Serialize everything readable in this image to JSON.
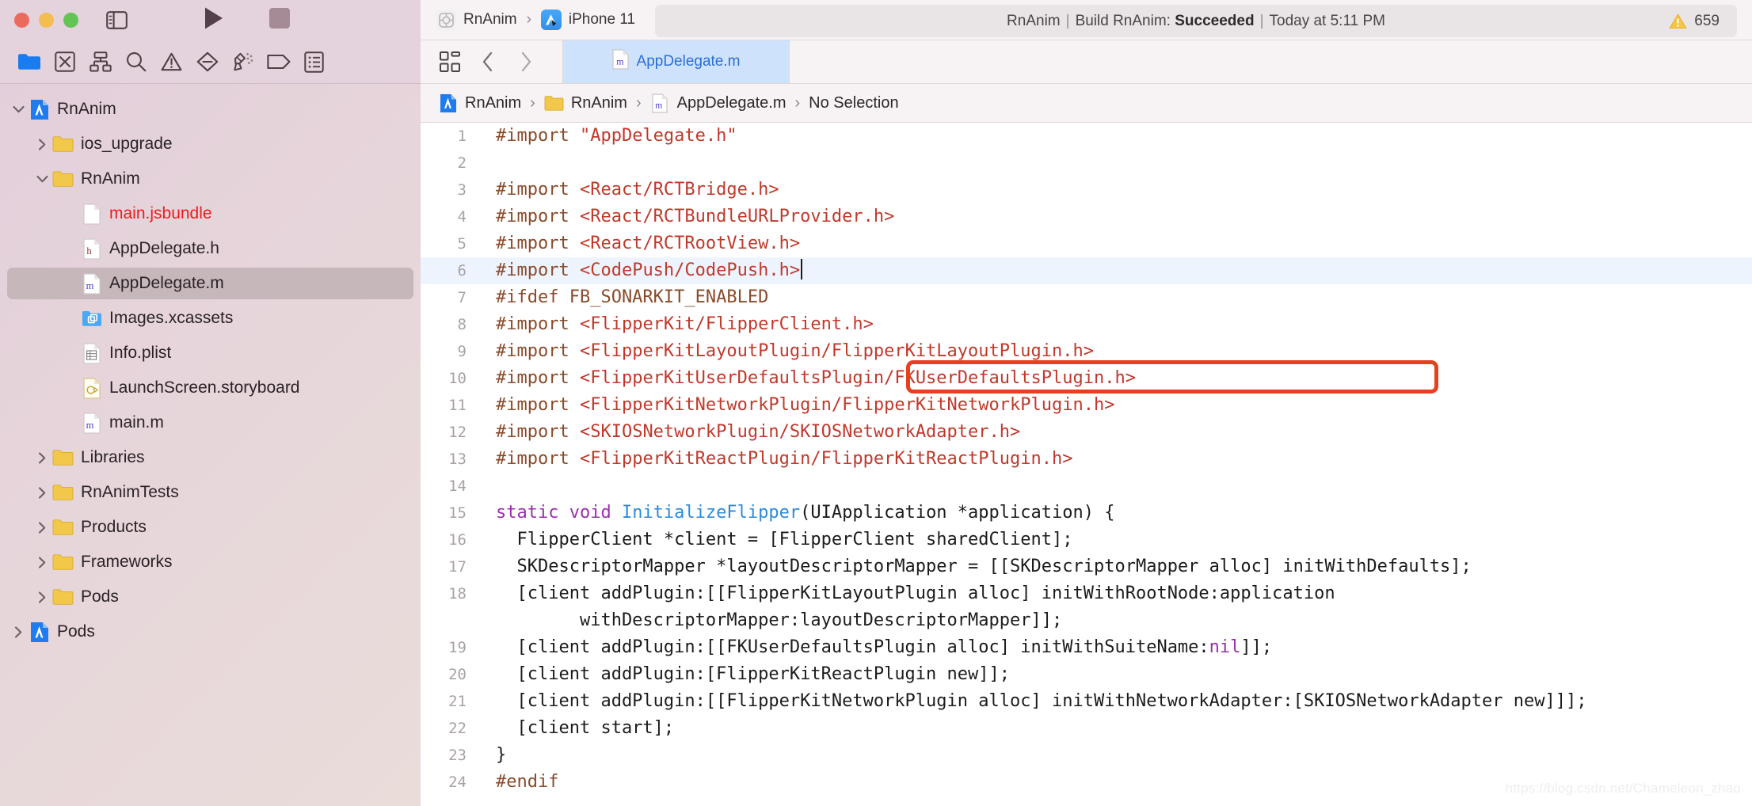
{
  "window": {
    "traffic_lights": [
      "close",
      "minimize",
      "zoom"
    ],
    "colors": {
      "titlebar_bg": "#e4d2dc",
      "toolbar_bg": "#f7f3f4",
      "sidebar_selection": "#c6b7bb",
      "tab_active_bg": "#cfe2fb",
      "tab_active_text": "#2b6fd4",
      "highlight_line_bg": "#eef4fd",
      "annotation_box": "#e8401f",
      "string_red": "#c0392b",
      "keyword_purple": "#9b2fae",
      "function_blue": "#2e8bd8",
      "preproc_brown": "#8a4b2a",
      "error_red": "#ee1c1c",
      "warning_yellow": "#f4bd4f"
    }
  },
  "toolbar": {
    "run_label": "Run",
    "stop_label": "Stop",
    "sidebar_toggle_label": "Toggle Navigator",
    "scheme": {
      "project_name": "RnAnim",
      "separator": "›",
      "destination": "iPhone 11"
    },
    "status": {
      "scheme": "RnAnim",
      "separator": "|",
      "action": "Build RnAnim:",
      "result": "Succeeded",
      "time": "Today at 5:11 PM"
    },
    "warnings": {
      "icon": "warning-triangle-icon",
      "count": "659"
    }
  },
  "navigator_toolbar": {
    "items": [
      {
        "name": "project-navigator",
        "icon": "folder-icon",
        "active": true
      },
      {
        "name": "source-control-navigator",
        "icon": "source-control-icon",
        "active": false
      },
      {
        "name": "symbol-navigator",
        "icon": "hierarchy-icon",
        "active": false
      },
      {
        "name": "find-navigator",
        "icon": "search-icon",
        "active": false
      },
      {
        "name": "issue-navigator",
        "icon": "warning-icon",
        "active": false
      },
      {
        "name": "test-navigator",
        "icon": "diamond-minus-icon",
        "active": false
      },
      {
        "name": "debug-navigator",
        "icon": "spray-icon",
        "active": false
      },
      {
        "name": "breakpoint-navigator",
        "icon": "tag-icon",
        "active": false
      },
      {
        "name": "report-navigator",
        "icon": "report-list-icon",
        "active": false
      }
    ]
  },
  "editor_header": {
    "jump_bar_icon": "related-items-icon",
    "back_icon": "chevron-left-icon",
    "forward_icon": "chevron-right-icon",
    "tab": {
      "icon": "objc-file-icon",
      "label": "AppDelegate.m"
    },
    "breadcrumb": [
      {
        "icon": "xcode-project-icon",
        "label": "RnAnim"
      },
      {
        "icon": "folder-icon",
        "label": "RnAnim"
      },
      {
        "icon": "objc-file-icon",
        "label": "AppDelegate.m"
      },
      {
        "icon": "none",
        "label": "No Selection"
      }
    ],
    "breadcrumb_separator": "›"
  },
  "sidebar": {
    "rows": [
      {
        "indent": 0,
        "disclosure": "open",
        "icon": "xcode-project-icon",
        "label": "RnAnim",
        "selected": false,
        "red": false
      },
      {
        "indent": 1,
        "disclosure": "closed",
        "icon": "folder-icon",
        "label": "ios_upgrade",
        "selected": false,
        "red": false
      },
      {
        "indent": 1,
        "disclosure": "open",
        "icon": "folder-icon",
        "label": "RnAnim",
        "selected": false,
        "red": false
      },
      {
        "indent": 2,
        "disclosure": "none",
        "icon": "blank-file-icon",
        "label": "main.jsbundle",
        "selected": false,
        "red": true
      },
      {
        "indent": 2,
        "disclosure": "none",
        "icon": "header-file-icon",
        "label": "AppDelegate.h",
        "selected": false,
        "red": false
      },
      {
        "indent": 2,
        "disclosure": "none",
        "icon": "objc-file-icon",
        "label": "AppDelegate.m",
        "selected": true,
        "red": false
      },
      {
        "indent": 2,
        "disclosure": "none",
        "icon": "xcassets-icon",
        "label": "Images.xcassets",
        "selected": false,
        "red": false
      },
      {
        "indent": 2,
        "disclosure": "none",
        "icon": "plist-file-icon",
        "label": "Info.plist",
        "selected": false,
        "red": false
      },
      {
        "indent": 2,
        "disclosure": "none",
        "icon": "storyboard-file-icon",
        "label": "LaunchScreen.storyboard",
        "selected": false,
        "red": false
      },
      {
        "indent": 2,
        "disclosure": "none",
        "icon": "objc-file-icon",
        "label": "main.m",
        "selected": false,
        "red": false
      },
      {
        "indent": 1,
        "disclosure": "closed",
        "icon": "folder-icon",
        "label": "Libraries",
        "selected": false,
        "red": false
      },
      {
        "indent": 1,
        "disclosure": "closed",
        "icon": "folder-icon",
        "label": "RnAnimTests",
        "selected": false,
        "red": false
      },
      {
        "indent": 1,
        "disclosure": "closed",
        "icon": "folder-icon",
        "label": "Products",
        "selected": false,
        "red": false
      },
      {
        "indent": 1,
        "disclosure": "closed",
        "icon": "folder-icon",
        "label": "Frameworks",
        "selected": false,
        "red": false
      },
      {
        "indent": 1,
        "disclosure": "closed",
        "icon": "folder-icon",
        "label": "Pods",
        "selected": false,
        "red": false
      },
      {
        "indent": 0,
        "disclosure": "closed",
        "icon": "xcode-project-icon",
        "label": "Pods",
        "selected": false,
        "red": false
      }
    ]
  },
  "code": {
    "highlighted_line": 6,
    "annotation": {
      "type": "red-rectangle",
      "around_line": 6
    },
    "lines": [
      {
        "n": "1",
        "tokens": [
          {
            "t": "#import ",
            "c": "pre"
          },
          {
            "t": "\"AppDelegate.h\"",
            "c": "str"
          }
        ]
      },
      {
        "n": "2",
        "tokens": []
      },
      {
        "n": "3",
        "tokens": [
          {
            "t": "#import ",
            "c": "pre"
          },
          {
            "t": "<React/RCTBridge.h>",
            "c": "str"
          }
        ]
      },
      {
        "n": "4",
        "tokens": [
          {
            "t": "#import ",
            "c": "pre"
          },
          {
            "t": "<React/RCTBundleURLProvider.h>",
            "c": "str"
          }
        ]
      },
      {
        "n": "5",
        "tokens": [
          {
            "t": "#import ",
            "c": "pre"
          },
          {
            "t": "<React/RCTRootView.h>",
            "c": "str"
          }
        ]
      },
      {
        "n": "6",
        "tokens": [
          {
            "t": "#import ",
            "c": "pre"
          },
          {
            "t": "<CodePush/CodePush.h>",
            "c": "str"
          },
          {
            "t": "",
            "c": "caret"
          }
        ]
      },
      {
        "n": "7",
        "tokens": [
          {
            "t": "#ifdef FB_SONARKIT_ENABLED",
            "c": "pre"
          }
        ]
      },
      {
        "n": "8",
        "tokens": [
          {
            "t": "#import ",
            "c": "pre"
          },
          {
            "t": "<FlipperKit/FlipperClient.h>",
            "c": "str"
          }
        ]
      },
      {
        "n": "9",
        "tokens": [
          {
            "t": "#import ",
            "c": "pre"
          },
          {
            "t": "<FlipperKitLayoutPlugin/FlipperKitLayoutPlugin.h>",
            "c": "str"
          }
        ]
      },
      {
        "n": "10",
        "tokens": [
          {
            "t": "#import ",
            "c": "pre"
          },
          {
            "t": "<FlipperKitUserDefaultsPlugin/FKUserDefaultsPlugin.h>",
            "c": "str"
          }
        ]
      },
      {
        "n": "11",
        "tokens": [
          {
            "t": "#import ",
            "c": "pre"
          },
          {
            "t": "<FlipperKitNetworkPlugin/FlipperKitNetworkPlugin.h>",
            "c": "str"
          }
        ]
      },
      {
        "n": "12",
        "tokens": [
          {
            "t": "#import ",
            "c": "pre"
          },
          {
            "t": "<SKIOSNetworkPlugin/SKIOSNetworkAdapter.h>",
            "c": "str"
          }
        ]
      },
      {
        "n": "13",
        "tokens": [
          {
            "t": "#import ",
            "c": "pre"
          },
          {
            "t": "<FlipperKitReactPlugin/FlipperKitReactPlugin.h>",
            "c": "str"
          }
        ]
      },
      {
        "n": "14",
        "tokens": []
      },
      {
        "n": "15",
        "tokens": [
          {
            "t": "static void ",
            "c": "key"
          },
          {
            "t": "InitializeFlipper",
            "c": "fn"
          },
          {
            "t": "(UIApplication *application) {",
            "c": "plain"
          }
        ]
      },
      {
        "n": "16",
        "tokens": [
          {
            "t": "  FlipperClient *client = [FlipperClient sharedClient];",
            "c": "plain"
          }
        ]
      },
      {
        "n": "17",
        "tokens": [
          {
            "t": "  SKDescriptorMapper *layoutDescriptorMapper = [[SKDescriptorMapper alloc] initWithDefaults];",
            "c": "plain"
          }
        ]
      },
      {
        "n": "18",
        "tokens": [
          {
            "t": "  [client addPlugin:[[FlipperKitLayoutPlugin alloc] initWithRootNode:application",
            "c": "plain"
          }
        ]
      },
      {
        "n": "",
        "tokens": [
          {
            "t": "        withDescriptorMapper:layoutDescriptorMapper]];",
            "c": "plain"
          }
        ]
      },
      {
        "n": "19",
        "tokens": [
          {
            "t": "  [client addPlugin:[[FKUserDefaultsPlugin alloc] initWithSuiteName:",
            "c": "plain"
          },
          {
            "t": "nil",
            "c": "key"
          },
          {
            "t": "]];",
            "c": "plain"
          }
        ]
      },
      {
        "n": "20",
        "tokens": [
          {
            "t": "  [client addPlugin:[FlipperKitReactPlugin new]];",
            "c": "plain"
          }
        ]
      },
      {
        "n": "21",
        "tokens": [
          {
            "t": "  [client addPlugin:[[FlipperKitNetworkPlugin alloc] initWithNetworkAdapter:[SKIOSNetworkAdapter new]]];",
            "c": "plain"
          }
        ]
      },
      {
        "n": "22",
        "tokens": [
          {
            "t": "  [client start];",
            "c": "plain"
          }
        ]
      },
      {
        "n": "23",
        "tokens": [
          {
            "t": "}",
            "c": "plain"
          }
        ]
      },
      {
        "n": "24",
        "tokens": [
          {
            "t": "#endif",
            "c": "pre"
          }
        ]
      }
    ]
  },
  "watermark": {
    "text": "https://blog.csdn.net/Chameleon_zhao"
  }
}
